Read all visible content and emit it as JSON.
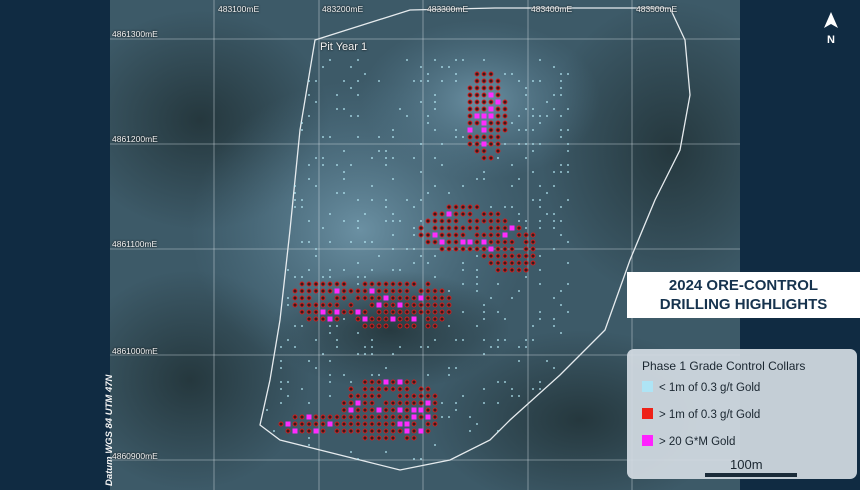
{
  "title": {
    "line1": "2024 ORE-CONTROL",
    "line2": "DRILLING HIGHLIGHTS"
  },
  "north_label": "N",
  "datum": "Datum WGS 84 UTM 47N",
  "pit_label": "Pit Year 1",
  "grid": {
    "easting_labels": [
      "483100mE",
      "483200mE",
      "483300mE",
      "483400mE",
      "483500mE"
    ],
    "northing_labels": [
      "4861300mE",
      "4861200mE",
      "4861100mE",
      "4861000mE",
      "4860900mE"
    ]
  },
  "legend": {
    "title": "Phase 1 Grade Control Collars",
    "items": [
      {
        "label": "< 1m of 0.3 g/t Gold",
        "color": "#aee4f5"
      },
      {
        "label": "> 1m of 0.3 g/t Gold",
        "color": "#ee2118"
      },
      {
        "label": "> 20 G*M Gold",
        "color": "#ff22ff"
      }
    ]
  },
  "scale_bar": {
    "label": "100m"
  },
  "colors": {
    "background": "#0d2a40",
    "collar_red": "#d91f1f",
    "collar_magenta": "#ff2bff",
    "collar_cyan": "#b8ecf8"
  }
}
